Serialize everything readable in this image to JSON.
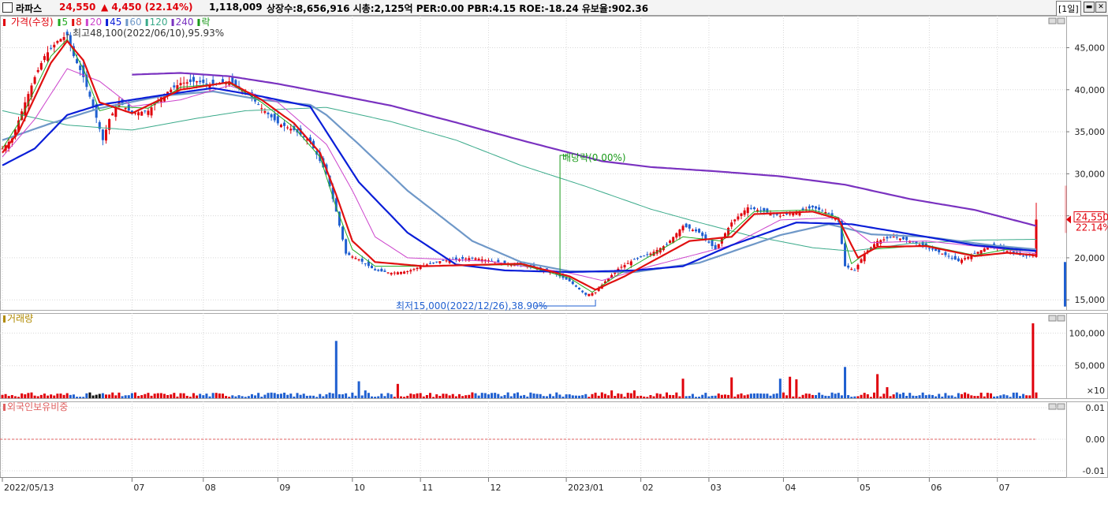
{
  "header": {
    "name": "라파스",
    "price": "24,550",
    "change": "▲  4,450",
    "change_pct": "(22.14%)",
    "volume": "1,118,009",
    "info": "상장수:8,656,916 시총:2,125억 PER:0.00 PBR:4.15 ROE:-18.24 유보율:902.36",
    "period": "[1일]"
  },
  "colors": {
    "up": "#e0000b",
    "down": "#1f5fd0",
    "ma5": "#22aa22",
    "ma8": "#e01010",
    "ma20": "#cc44cc",
    "ma45": "#0a1ed8",
    "ma60": "#6f98c8",
    "ma120": "#3aaa8a",
    "ma240": "#7a32c0",
    "ex": "#1a9a1a"
  },
  "legend": {
    "price": "가격(수정)",
    "ma": [
      {
        "key": "ma5",
        "label": "5"
      },
      {
        "key": "ma8",
        "label": "8"
      },
      {
        "key": "ma20",
        "label": "20"
      },
      {
        "key": "ma45",
        "label": "45"
      },
      {
        "key": "ma60",
        "label": "60"
      },
      {
        "key": "ma120",
        "label": "120"
      },
      {
        "key": "ma240",
        "label": "240"
      }
    ],
    "ex": "락"
  },
  "annotations": {
    "high": "최고48,100(2022/06/10),95.93%",
    "low": "최저15,000(2022/12/26),38.90%",
    "dividend": "배당락(0.00%)"
  },
  "price_tag": {
    "value": "24,550",
    "pct": "22.14%"
  },
  "volume_title": "거래량",
  "foreign_title": "외국인보유비중",
  "chart_data": [
    {
      "type": "candlestick",
      "title": "가격(수정)",
      "x_ticks": [
        "2022/05/13",
        "07",
        "08",
        "09",
        "10",
        "11",
        "12",
        "2023/01",
        "02",
        "03",
        "04",
        "05",
        "06",
        "07"
      ],
      "y_ticks": [
        "45,000",
        "40,000",
        "35,000",
        "30,000",
        "25,000",
        "20,000",
        "15,000"
      ],
      "ylim": [
        13800,
        48800
      ],
      "close_anchors": [
        [
          0,
          33000
        ],
        [
          3,
          34200
        ],
        [
          7,
          38500
        ],
        [
          10,
          41500
        ],
        [
          13,
          44000
        ],
        [
          17,
          45800
        ],
        [
          20,
          46500
        ],
        [
          22,
          44000
        ],
        [
          25,
          41500
        ],
        [
          28,
          38000
        ],
        [
          31,
          34000
        ],
        [
          33,
          36500
        ],
        [
          36,
          38500
        ],
        [
          40,
          37200
        ],
        [
          45,
          37500
        ],
        [
          50,
          39500
        ],
        [
          55,
          40800
        ],
        [
          60,
          41000
        ],
        [
          65,
          40500
        ],
        [
          70,
          41000
        ],
        [
          75,
          39800
        ],
        [
          80,
          37800
        ],
        [
          85,
          36000
        ],
        [
          90,
          35200
        ],
        [
          95,
          33800
        ],
        [
          100,
          30000
        ],
        [
          103,
          25500
        ],
        [
          106,
          20500
        ],
        [
          110,
          19800
        ],
        [
          115,
          18500
        ],
        [
          120,
          18200
        ],
        [
          125,
          18400
        ],
        [
          130,
          19100
        ],
        [
          135,
          19600
        ],
        [
          140,
          19800
        ],
        [
          145,
          20000
        ],
        [
          150,
          19700
        ],
        [
          155,
          19300
        ],
        [
          160,
          19200
        ],
        [
          165,
          18700
        ],
        [
          170,
          18200
        ],
        [
          175,
          17200
        ],
        [
          180,
          15600
        ],
        [
          183,
          15900
        ],
        [
          186,
          17200
        ],
        [
          190,
          18700
        ],
        [
          195,
          19800
        ],
        [
          200,
          20500
        ],
        [
          205,
          21600
        ],
        [
          210,
          23800
        ],
        [
          215,
          23000
        ],
        [
          220,
          21000
        ],
        [
          225,
          24200
        ],
        [
          230,
          26000
        ],
        [
          235,
          25500
        ],
        [
          240,
          25000
        ],
        [
          245,
          25400
        ],
        [
          250,
          26000
        ],
        [
          255,
          25300
        ],
        [
          258,
          24300
        ],
        [
          260,
          19000
        ],
        [
          263,
          18500
        ],
        [
          266,
          20500
        ],
        [
          270,
          22000
        ],
        [
          275,
          22500
        ],
        [
          280,
          22000
        ],
        [
          285,
          21300
        ],
        [
          290,
          20500
        ],
        [
          295,
          19600
        ],
        [
          300,
          20500
        ],
        [
          305,
          21500
        ],
        [
          310,
          20800
        ],
        [
          315,
          20200
        ],
        [
          318,
          20300
        ],
        [
          319,
          24550
        ]
      ],
      "moving_averages": {
        "ma5": [
          [
            0,
            33000
          ],
          [
            5,
            36000
          ],
          [
            15,
            44000
          ],
          [
            20,
            46000
          ],
          [
            25,
            42500
          ],
          [
            30,
            37500
          ],
          [
            35,
            38000
          ],
          [
            45,
            37800
          ],
          [
            55,
            40300
          ],
          [
            70,
            40800
          ],
          [
            80,
            38500
          ],
          [
            90,
            35500
          ],
          [
            98,
            32000
          ],
          [
            103,
            26000
          ],
          [
            108,
            21000
          ],
          [
            115,
            19000
          ],
          [
            130,
            19000
          ],
          [
            160,
            19200
          ],
          [
            175,
            17600
          ],
          [
            182,
            15900
          ],
          [
            190,
            18000
          ],
          [
            210,
            22500
          ],
          [
            222,
            22000
          ],
          [
            232,
            25500
          ],
          [
            250,
            25700
          ],
          [
            258,
            24800
          ],
          [
            262,
            19300
          ],
          [
            268,
            21000
          ],
          [
            285,
            21500
          ],
          [
            300,
            20300
          ],
          [
            310,
            21000
          ],
          [
            319,
            20800
          ]
        ],
        "ma8": [
          [
            0,
            32500
          ],
          [
            5,
            35000
          ],
          [
            15,
            43200
          ],
          [
            20,
            45800
          ],
          [
            25,
            43500
          ],
          [
            30,
            38500
          ],
          [
            40,
            37200
          ],
          [
            55,
            40000
          ],
          [
            70,
            40900
          ],
          [
            80,
            38800
          ],
          [
            90,
            36000
          ],
          [
            98,
            32500
          ],
          [
            103,
            27500
          ],
          [
            108,
            22000
          ],
          [
            115,
            19500
          ],
          [
            130,
            19000
          ],
          [
            160,
            19300
          ],
          [
            175,
            17800
          ],
          [
            183,
            16200
          ],
          [
            192,
            17800
          ],
          [
            212,
            22000
          ],
          [
            225,
            22500
          ],
          [
            232,
            25200
          ],
          [
            250,
            25500
          ],
          [
            258,
            24600
          ],
          [
            264,
            20000
          ],
          [
            270,
            21300
          ],
          [
            285,
            21400
          ],
          [
            300,
            20200
          ],
          [
            310,
            20600
          ],
          [
            319,
            20300
          ]
        ],
        "ma20": [
          [
            0,
            32000
          ],
          [
            10,
            36500
          ],
          [
            20,
            42500
          ],
          [
            30,
            41000
          ],
          [
            40,
            38000
          ],
          [
            55,
            38800
          ],
          [
            70,
            40500
          ],
          [
            85,
            38500
          ],
          [
            100,
            33500
          ],
          [
            108,
            28000
          ],
          [
            115,
            22500
          ],
          [
            125,
            20000
          ],
          [
            150,
            19600
          ],
          [
            175,
            18200
          ],
          [
            185,
            17300
          ],
          [
            200,
            19000
          ],
          [
            225,
            21500
          ],
          [
            240,
            24500
          ],
          [
            258,
            24800
          ],
          [
            268,
            21800
          ],
          [
            285,
            22000
          ],
          [
            305,
            21200
          ],
          [
            319,
            20500
          ]
        ],
        "ma45": [
          [
            0,
            31000
          ],
          [
            10,
            33000
          ],
          [
            20,
            37000
          ],
          [
            30,
            38200
          ],
          [
            50,
            39400
          ],
          [
            65,
            40200
          ],
          [
            80,
            39200
          ],
          [
            95,
            38000
          ],
          [
            100,
            35000
          ],
          [
            110,
            29000
          ],
          [
            125,
            23000
          ],
          [
            140,
            19200
          ],
          [
            155,
            18500
          ],
          [
            175,
            18300
          ],
          [
            195,
            18500
          ],
          [
            210,
            19000
          ],
          [
            225,
            21500
          ],
          [
            245,
            24200
          ],
          [
            262,
            24000
          ],
          [
            285,
            22500
          ],
          [
            300,
            21500
          ],
          [
            319,
            20800
          ]
        ],
        "ma60": [
          [
            0,
            34000
          ],
          [
            15,
            36000
          ],
          [
            30,
            37800
          ],
          [
            50,
            39300
          ],
          [
            65,
            39800
          ],
          [
            80,
            38800
          ],
          [
            95,
            38200
          ],
          [
            100,
            37000
          ],
          [
            110,
            33500
          ],
          [
            125,
            28000
          ],
          [
            145,
            22000
          ],
          [
            160,
            19500
          ],
          [
            175,
            18400
          ],
          [
            195,
            18300
          ],
          [
            215,
            19400
          ],
          [
            240,
            22700
          ],
          [
            255,
            24000
          ],
          [
            268,
            22800
          ],
          [
            285,
            22500
          ],
          [
            305,
            21500
          ],
          [
            319,
            21000
          ]
        ],
        "ma120": [
          [
            0,
            37500
          ],
          [
            20,
            35800
          ],
          [
            40,
            35200
          ],
          [
            60,
            36600
          ],
          [
            75,
            37500
          ],
          [
            100,
            37900
          ],
          [
            120,
            36200
          ],
          [
            140,
            34000
          ],
          [
            160,
            31000
          ],
          [
            180,
            28500
          ],
          [
            200,
            25800
          ],
          [
            215,
            24200
          ],
          [
            230,
            22700
          ],
          [
            250,
            21200
          ],
          [
            262,
            20800
          ],
          [
            280,
            21700
          ],
          [
            300,
            22100
          ],
          [
            319,
            22200
          ]
        ],
        "ma240": [
          [
            40,
            41800
          ],
          [
            55,
            42000
          ],
          [
            70,
            41600
          ],
          [
            85,
            40700
          ],
          [
            100,
            39600
          ],
          [
            120,
            38100
          ],
          [
            140,
            36100
          ],
          [
            160,
            34000
          ],
          [
            175,
            32500
          ],
          [
            185,
            31500
          ],
          [
            200,
            30800
          ],
          [
            220,
            30300
          ],
          [
            240,
            29700
          ],
          [
            260,
            28700
          ],
          [
            280,
            27000
          ],
          [
            300,
            25700
          ],
          [
            319,
            23800
          ]
        ]
      }
    },
    {
      "type": "bar",
      "title": "거래량",
      "y_ticks": [
        "100,000",
        "50,000"
      ],
      "y_unit": "×10",
      "ylim": [
        0,
        115000
      ],
      "base_range": [
        2000,
        9000
      ],
      "spikes": [
        [
          103,
          88000
        ],
        [
          110,
          26000
        ],
        [
          112,
          12000
        ],
        [
          122,
          22000
        ],
        [
          145,
          9000
        ],
        [
          185,
          9000
        ],
        [
          188,
          12000
        ],
        [
          195,
          12000
        ],
        [
          210,
          30000
        ],
        [
          225,
          32000
        ],
        [
          240,
          30000
        ],
        [
          243,
          33000
        ],
        [
          245,
          29000
        ],
        [
          260,
          48000
        ],
        [
          270,
          37000
        ],
        [
          273,
          17000
        ],
        [
          318,
          115000
        ]
      ]
    },
    {
      "type": "line",
      "title": "외국인보유비중",
      "y_ticks": [
        "0.01",
        "0.00",
        "-0.01"
      ],
      "ylim": [
        -0.012,
        0.012
      ],
      "values": [
        0
      ]
    }
  ]
}
